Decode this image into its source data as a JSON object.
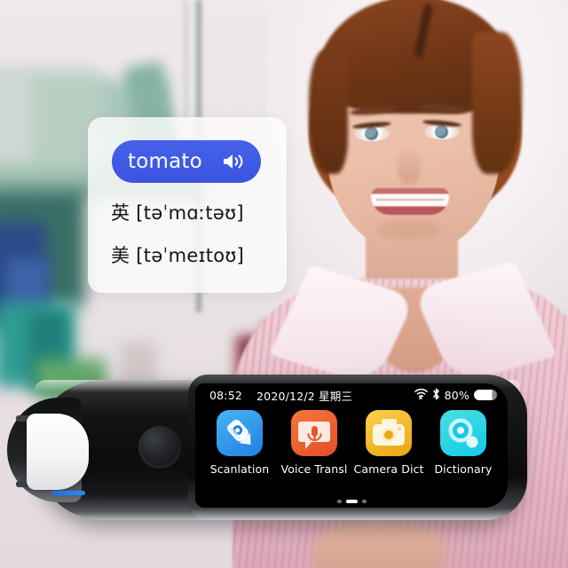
{
  "translation_card": {
    "word": "tomato",
    "speaker_icon": "speaker-icon",
    "pronunciations": [
      {
        "locale_label": "英",
        "ipa": "[təˈmɑːtəʊ]"
      },
      {
        "locale_label": "美",
        "ipa": "[təˈmeɪtoʊ]"
      }
    ]
  },
  "device": {
    "status_bar": {
      "time": "08:52",
      "date": "2020/12/2 星期三",
      "wifi_icon": "wifi-off-icon",
      "bluetooth_icon": "bluetooth-icon",
      "battery_percent": "80%",
      "battery_icon": "battery-icon"
    },
    "apps": [
      {
        "label": "Scanlation",
        "icon": "scan-pen-icon",
        "color": "#2b94ea"
      },
      {
        "label": "Voice Transl",
        "icon": "voice-bubble-icon",
        "color": "#ee6033"
      },
      {
        "label": "Camera Dict",
        "icon": "camera-icon",
        "color": "#f3b92c"
      },
      {
        "label": "Dictionary",
        "icon": "magnifier-icon",
        "color": "#25d3e4"
      }
    ],
    "page_indicator": {
      "total": 3,
      "active_index": 1
    },
    "scanner_tip": "scanner-tip",
    "shutter_button": "shutter-button"
  },
  "colors": {
    "pill_blue": "#3f5ae5",
    "screen_black": "#000000",
    "scan_line_blue": "#2a7ced"
  }
}
